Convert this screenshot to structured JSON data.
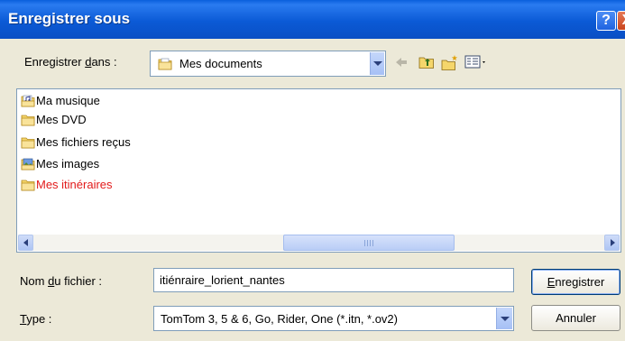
{
  "window": {
    "title": "Enregistrer sous",
    "help_glyph": "?",
    "close_glyph": "X"
  },
  "save_in": {
    "label_pre": "Enregistrer ",
    "label_ul": "d",
    "label_post": "ans :",
    "value": "Mes documents",
    "icon": "my-documents-folder-icon"
  },
  "toolbar": {
    "icons": [
      "back-arrow-icon",
      "up-one-level-icon",
      "new-folder-icon",
      "view-menu-icon"
    ]
  },
  "file_list": {
    "items": [
      {
        "label": "Ma musique",
        "icon": "music-folder-icon"
      },
      {
        "label": "Mes DVD",
        "icon": "folder-icon"
      },
      {
        "label": "Mes fichiers reçus",
        "icon": "folder-icon"
      },
      {
        "label": "Mes images",
        "icon": "pictures-folder-icon"
      },
      {
        "label": "Mes itinéraires",
        "icon": "folder-icon",
        "highlight_color": "#e21a1a"
      }
    ],
    "horizontal_scroll_position": 0.45
  },
  "filename": {
    "label_pre": "Nom ",
    "label_ul": "d",
    "label_post": "u fichier :",
    "value": "itiénraire_lorient_nantes"
  },
  "type": {
    "label_ul": "T",
    "label_post": "ype :",
    "value": "TomTom 3, 5 & 6, Go, Rider, One (*.itn, *.ov2)"
  },
  "buttons": {
    "save_ul": "E",
    "save_post": "nregistrer",
    "cancel": "Annuler"
  },
  "colors": {
    "title_bar": "#0b5ad6",
    "dialog_bg": "#ece9d8",
    "highlight_red": "#e21a1a"
  }
}
